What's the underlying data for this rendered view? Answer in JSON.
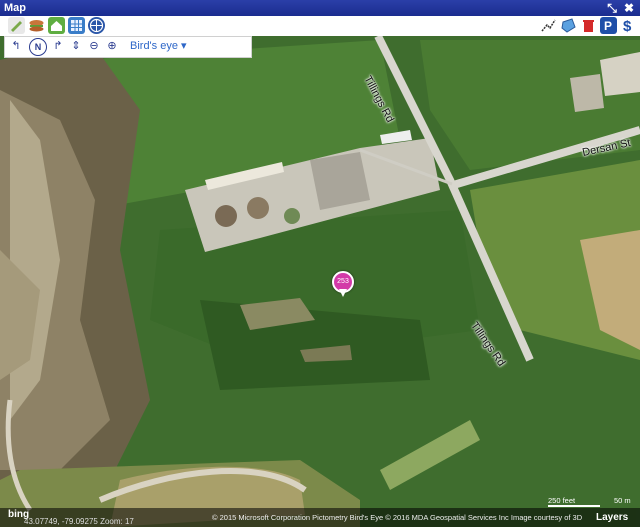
{
  "window": {
    "title": "Map",
    "minimize_glyph": "⤡",
    "close_glyph": "✖"
  },
  "toolbar": {
    "left_icons": [
      "edit-icon",
      "hamburger-icon",
      "home-icon",
      "grid-icon",
      "globe-icon"
    ],
    "right_icons": [
      "route-icon",
      "shape-icon",
      "trash-icon",
      "parking-icon",
      "dollar-icon"
    ]
  },
  "nav": {
    "birds_eye_label": "Bird's eye ▾",
    "compass_label": "N"
  },
  "map": {
    "roads": [
      "Tillings Rd",
      "Dersan St",
      "Tillings Rd"
    ],
    "pin_label": "253"
  },
  "footer": {
    "bing": "bing",
    "coords": "43.07749, -79.09275 Zoom: 17",
    "copyright": "© 2015 Microsoft Corporation   Pictometry Bird's Eye © 2016 MDA Geospatial Services Inc   Image courtesy of 3D",
    "scale_feet": "250 feet",
    "scale_m": "50 m",
    "layers": "Layers"
  }
}
